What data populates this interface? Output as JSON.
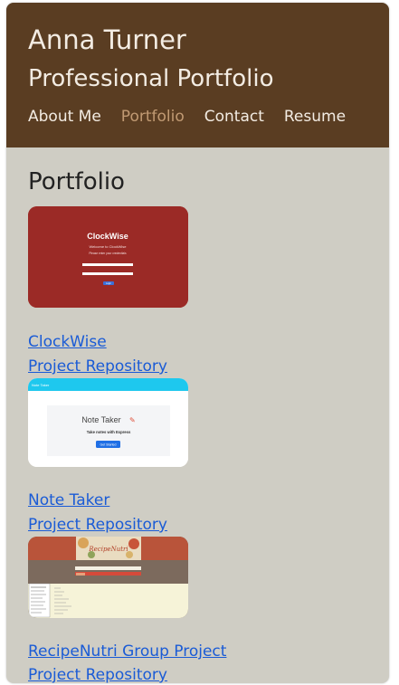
{
  "header": {
    "name": "Anna Turner",
    "subtitle": "Professional Portfolio",
    "nav": [
      {
        "label": "About Me"
      },
      {
        "label": "Portfolio"
      },
      {
        "label": "Contact"
      },
      {
        "label": "Resume"
      }
    ],
    "active_nav": "Portfolio"
  },
  "portfolio": {
    "title": "Portfolio",
    "projects": [
      {
        "name": "ClockWise",
        "repo_label": "Project Repository",
        "thumb": {
          "app_title": "ClockWise",
          "tagline": "Welcome to ClockWise",
          "subline": "Please enter your credentials",
          "button": "Login"
        }
      },
      {
        "name": "Note Taker",
        "repo_label": "Project Repository",
        "thumb": {
          "nav": "Note Taker",
          "title": "Note Taker",
          "tagline": "Take notes with Express",
          "button": "Get Started"
        }
      },
      {
        "name": "RecipeNutri Group Project",
        "repo_label": "Project Repository",
        "thumb": {
          "title": "RecipeNutri"
        }
      }
    ]
  },
  "colors": {
    "header_bg": "#5a3d22",
    "page_bg": "#cfcdc4",
    "nav_active": "#c19a73",
    "link": "#1a5bd6"
  }
}
